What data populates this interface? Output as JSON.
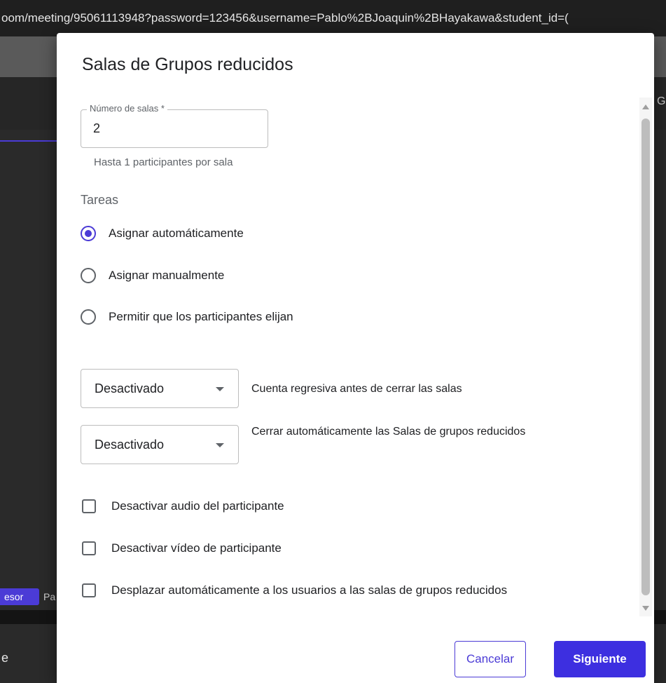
{
  "browser": {
    "url": "oom/meeting/95061113948?password=123456&username=Pablo%2BJoaquin%2BHayakawa&student_id=("
  },
  "background": {
    "chip_label": "esor",
    "chip_next": "Pa",
    "right_fragment": "G",
    "bottom_fragment": "e"
  },
  "dialog": {
    "title": "Salas de Grupos reducidos",
    "rooms_field": {
      "label": "Número de salas *",
      "value": "2",
      "hint": "Hasta 1 participantes por sala"
    },
    "tasks": {
      "label": "Tareas",
      "options": [
        {
          "label": "Asignar automáticamente",
          "selected": true
        },
        {
          "label": "Asignar manualmente",
          "selected": false
        },
        {
          "label": "Permitir que los participantes elijan",
          "selected": false
        }
      ]
    },
    "countdown": {
      "value": "Desactivado",
      "description": "Cuenta regresiva antes de cerrar las salas"
    },
    "auto_close": {
      "value": "Desactivado",
      "description": "Cerrar automáticamente las Salas de grupos reducidos"
    },
    "checkboxes": [
      {
        "label": "Desactivar audio del participante",
        "checked": false
      },
      {
        "label": "Desactivar vídeo de participante",
        "checked": false
      },
      {
        "label": "Desplazar automáticamente a los usuarios a las salas de grupos reducidos",
        "checked": false
      }
    ],
    "buttons": {
      "cancel": "Cancelar",
      "next": "Siguiente"
    }
  },
  "colors": {
    "accent": "#4b3bd6",
    "primary_button": "#3d2fe0"
  }
}
